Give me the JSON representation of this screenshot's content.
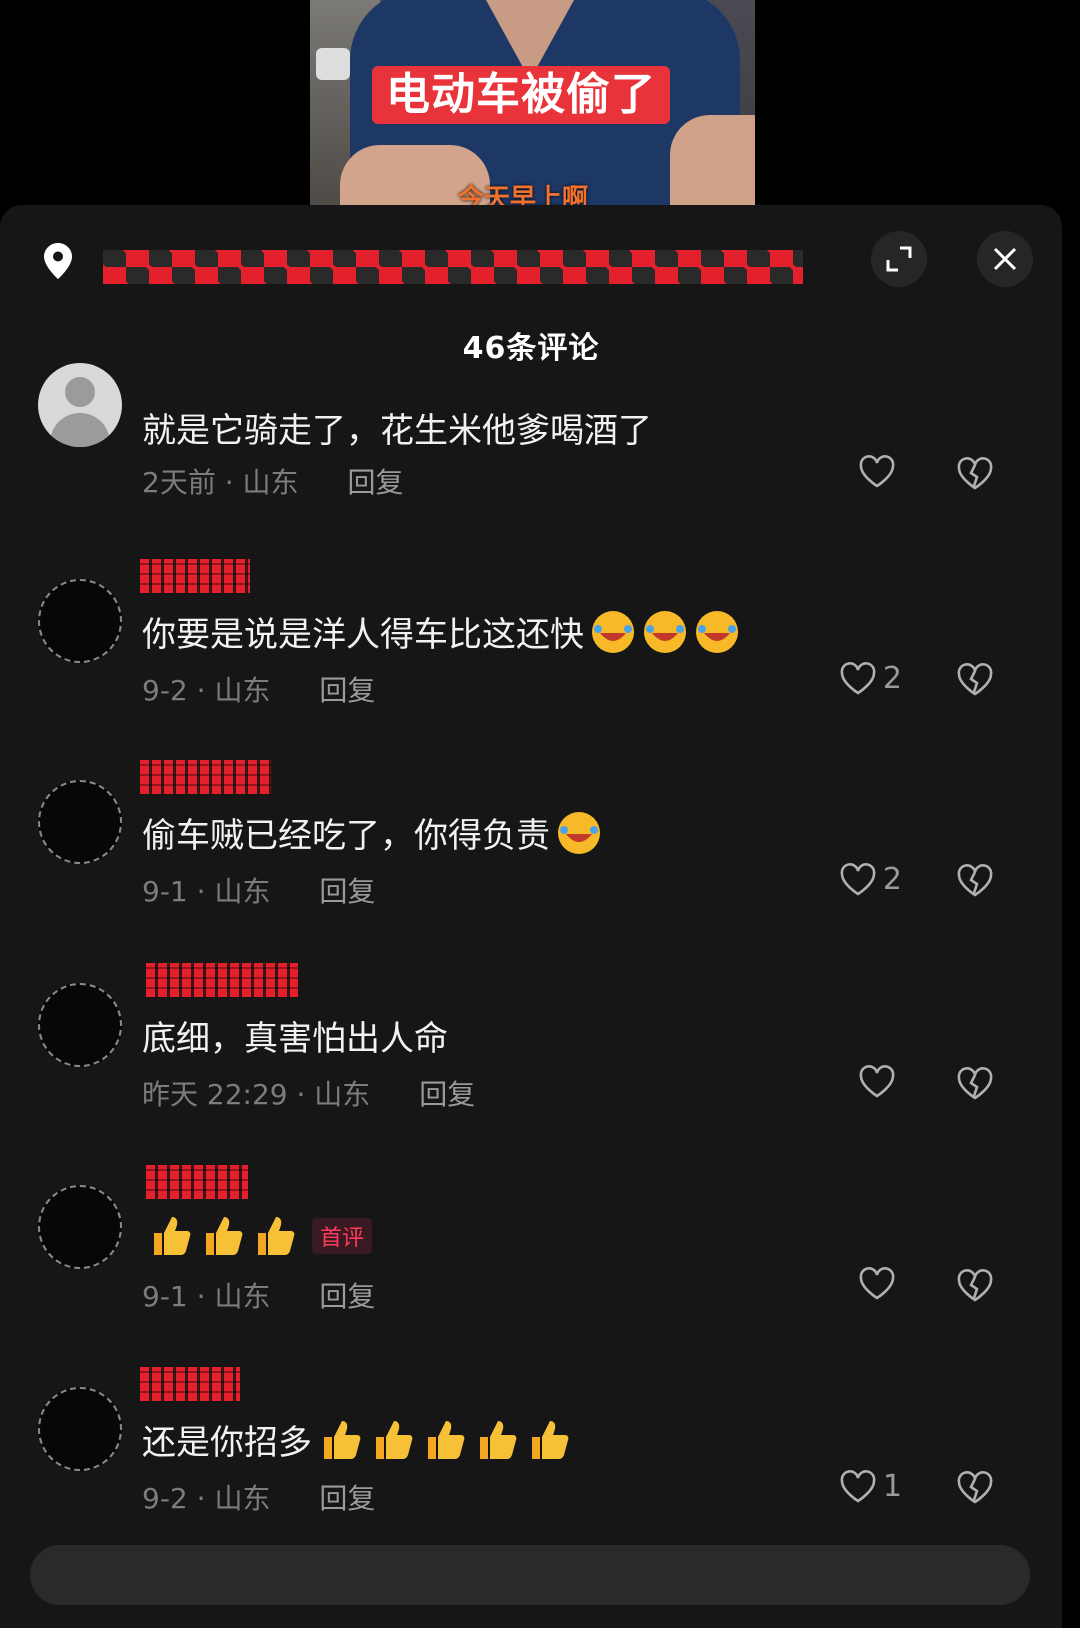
{
  "video": {
    "caption": "电动车被偷了",
    "subcaption": "今天早上啊"
  },
  "header": {
    "comment_count": "46条评论"
  },
  "comments": [
    {
      "text": "就是它骑走了，花生米他爹喝酒了",
      "time": "2天前",
      "region": "山东",
      "reply": "回复",
      "likes": ""
    },
    {
      "text": "你要是说是洋人得车比这还快",
      "emoji_faces": 3,
      "time": "9-2",
      "region": "山东",
      "reply": "回复",
      "likes": "2"
    },
    {
      "text": "偷车贼已经吃了，你得负责",
      "emoji_faces": 1,
      "time": "9-1",
      "region": "山东",
      "reply": "回复",
      "likes": "2"
    },
    {
      "text": "底细，真害怕出人命",
      "time": "昨天 22:29",
      "region": "山东",
      "reply": "回复",
      "likes": ""
    },
    {
      "text": "",
      "emoji_thumbs": 3,
      "badge": "首评",
      "time": "9-1",
      "region": "山东",
      "reply": "回复",
      "likes": ""
    },
    {
      "text": "还是你招多",
      "emoji_thumbs": 5,
      "time": "9-2",
      "region": "山东",
      "reply": "回复",
      "likes": "1"
    }
  ],
  "colors": {
    "background": "#000000",
    "sheet": "#161616",
    "redaction": "#e4202c",
    "caption_bg": "#e8333a",
    "meta": "#7c7c7c",
    "badge": "#ff3b5c"
  },
  "icons": [
    "location-pin-icon",
    "expand-icon",
    "close-icon",
    "heart-icon",
    "broken-heart-icon"
  ]
}
